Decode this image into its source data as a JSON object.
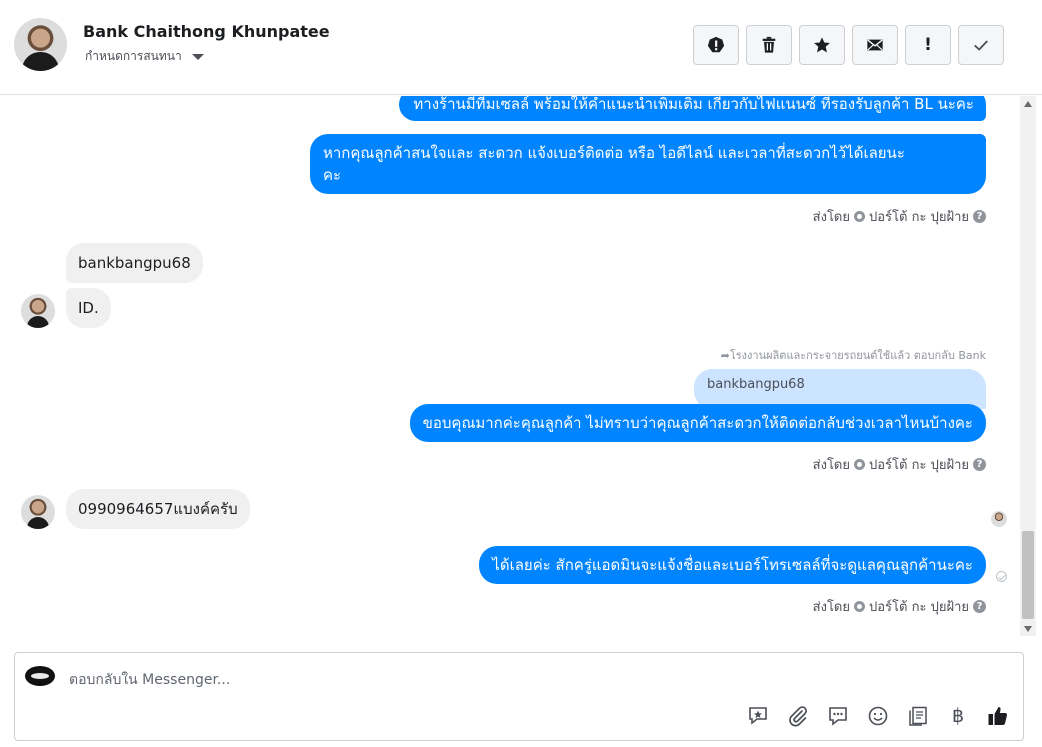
{
  "header": {
    "name": "Bank Chaithong Khunpatee",
    "subtitle": "กำหนดการสนทนา"
  },
  "toolbar": {
    "icons": [
      "alert-icon",
      "trash-icon",
      "star-icon",
      "envelope-icon",
      "exclamation-icon",
      "checkmark-icon"
    ],
    "exclamation_label": "!"
  },
  "messages": {
    "out_1": "ทางร้านมีทีมเซลล์ พร้อมให้คำแนะนำเพิ่มเติม เกี่ยวกับไฟแนนซ์ ที่รองรับลูกค้า BL นะคะ",
    "out_2_line1": "หากคุณลูกค้าสนใจและ สะดวก แจ้งเบอร์ติดต่อ หรือ ไอดีไลน์ และเวลาที่สะดวกไว้ได้เลยนะ",
    "out_2_line2": "คะ",
    "sent_by_1_prefix": "ส่งโดย",
    "sent_by_1_name": "ปอร์โต้ กะ ปุยฝ้าย",
    "in_1": "bankbangpu68",
    "in_2": "ID.",
    "reply_note": "โรงงานผลิตและกระจายรถยนต์ใช้แล้ว ตอบกลับ Bank",
    "quoted_text": "bankbangpu68",
    "out_3": "ขอบคุณมากค่ะคุณลูกค้า ไม่ทราบว่าคุณลูกค้าสะดวกให้ติดต่อกลับช่วงเวลาไหนบ้างคะ",
    "sent_by_2_prefix": "ส่งโดย",
    "sent_by_2_name": "ปอร์โต้ กะ ปุยฝ้าย",
    "in_3": "0990964657แบงค์ครับ",
    "out_4": "ได้เลยค่ะ สักครู่แอดมินจะแจ้งชื่อและเบอร์โทรเซลล์ที่จะดูแลคุณลูกค้านะคะ",
    "sent_by_3_prefix": "ส่งโดย",
    "sent_by_3_name": "ปอร์โต้ กะ ปุยฝ้าย",
    "help_glyph": "?"
  },
  "composer": {
    "placeholder": "ตอบกลับใน Messenger...",
    "icons": [
      "sticker-icon",
      "paperclip-icon",
      "chat-bubble-icon",
      "emoji-icon",
      "saved-replies-icon",
      "baht-icon",
      "thumbs-up-icon"
    ],
    "baht_glyph": "฿"
  },
  "colors": {
    "outgoing_bubble": "#0084ff",
    "incoming_bubble": "#f1f0f0",
    "quoted_bubble": "#cce4ff"
  }
}
